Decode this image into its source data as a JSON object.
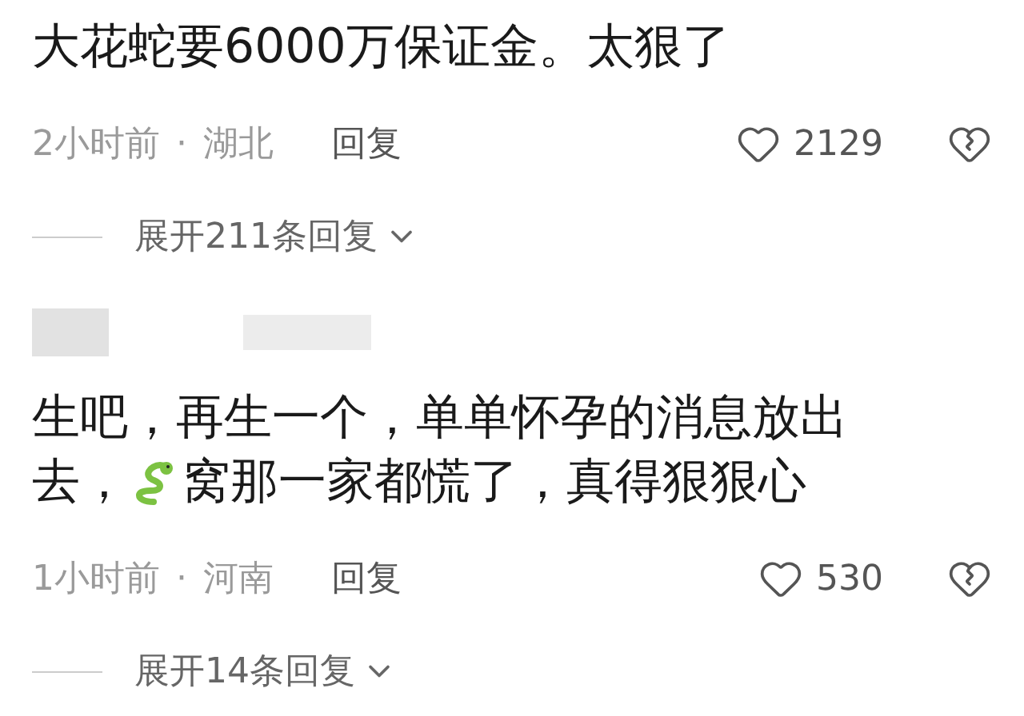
{
  "comments": [
    {
      "redacted": false,
      "lines": [
        [
          {
            "kind": "text",
            "text": "大花蛇要6000万保证金。太狠了"
          }
        ]
      ],
      "time": "2小时前",
      "dot": "·",
      "location": "湖北",
      "reply": "回复",
      "likes": "2129",
      "expand": "展开211条回复"
    },
    {
      "redacted": true,
      "lines": [
        [
          {
            "kind": "text",
            "text": "生吧，再生一个，单单怀孕的消息放出"
          }
        ],
        [
          {
            "kind": "text",
            "text": "去，"
          },
          {
            "kind": "emoji"
          },
          {
            "kind": "text",
            "text": "窝那一家都慌了，真得狠狠心"
          }
        ]
      ],
      "time": "1小时前",
      "dot": "·",
      "location": "河南",
      "reply": "回复",
      "likes": "530",
      "expand": "展开14条回复"
    }
  ]
}
